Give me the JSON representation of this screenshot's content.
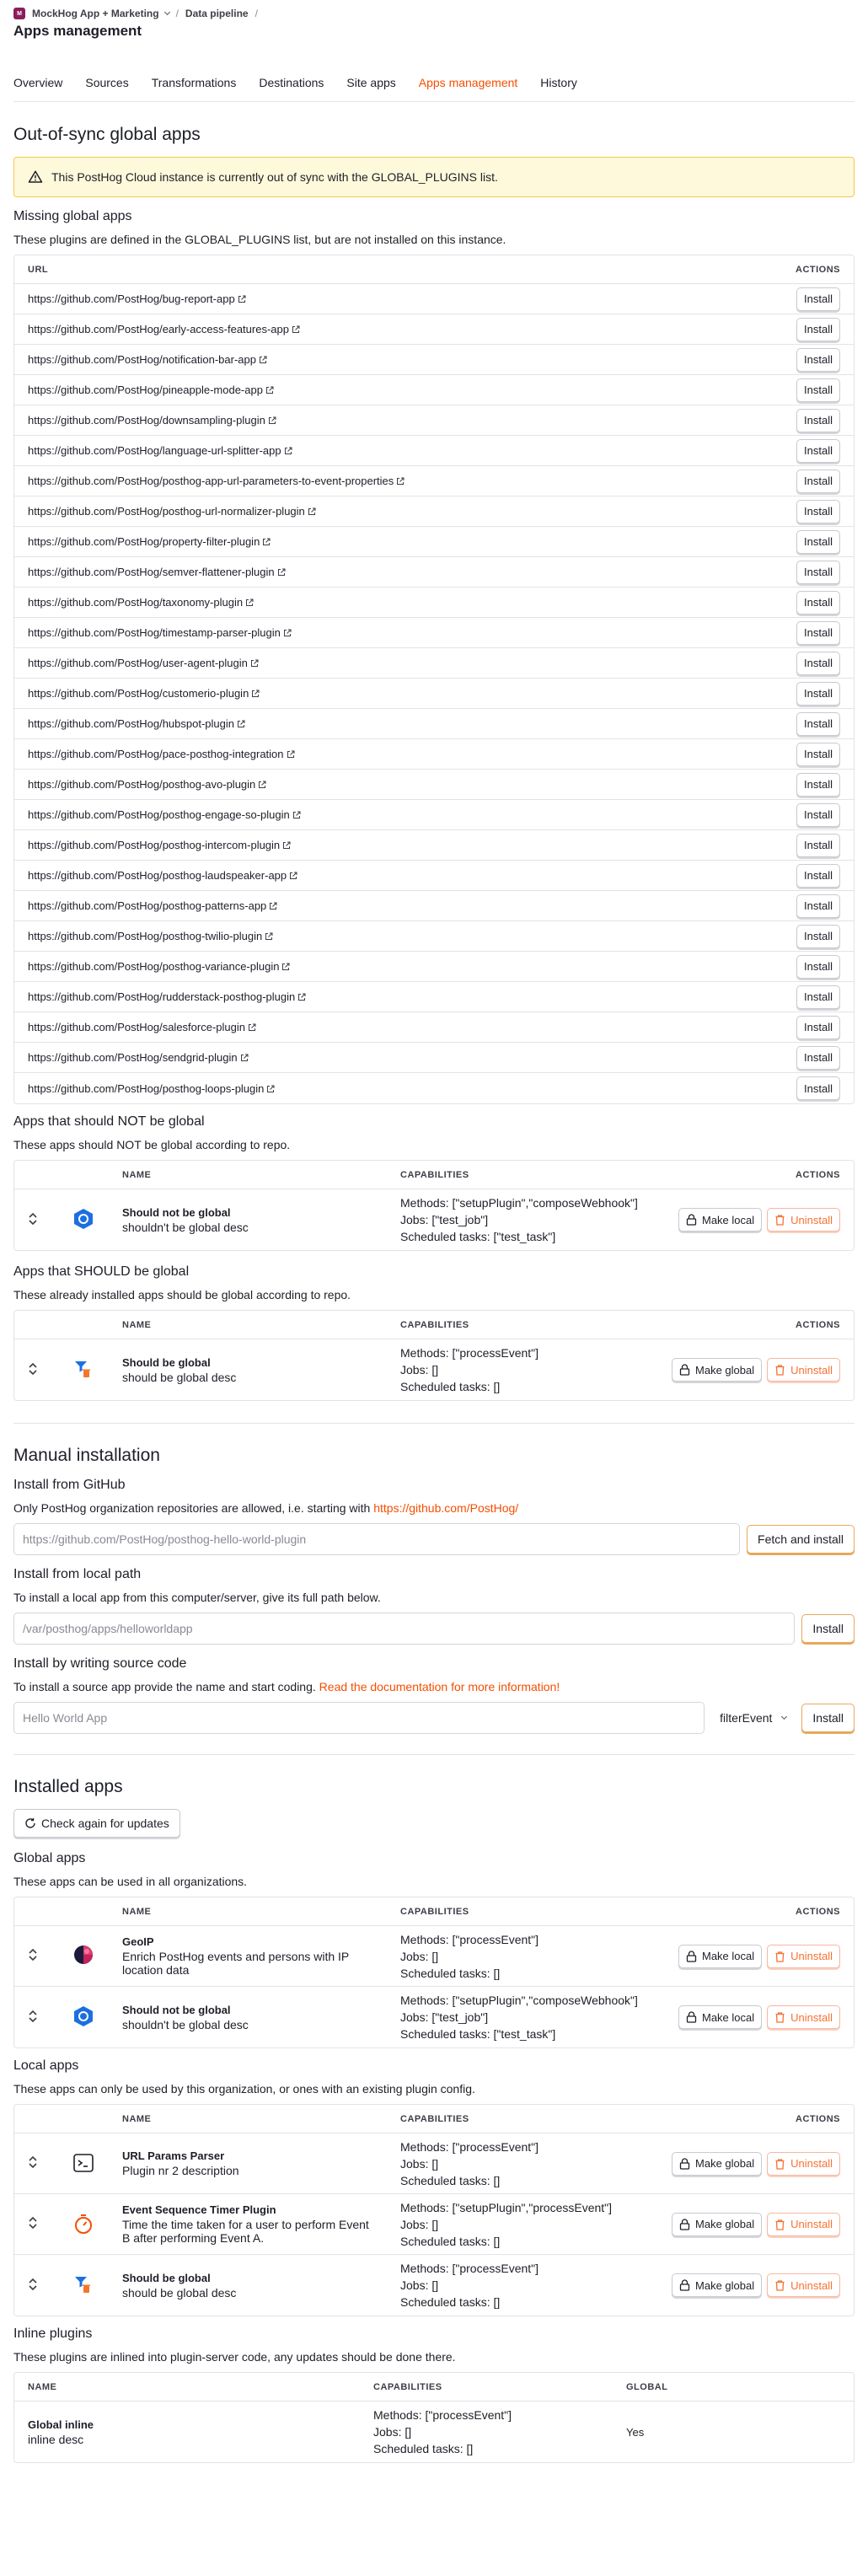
{
  "header": {
    "org_badge": "M",
    "breadcrumb_project": "MockHog App + Marketing",
    "breadcrumb_section": "Data pipeline",
    "title": "Apps management"
  },
  "tabs": [
    {
      "label": "Overview"
    },
    {
      "label": "Sources"
    },
    {
      "label": "Transformations"
    },
    {
      "label": "Destinations"
    },
    {
      "label": "Site apps"
    },
    {
      "label": "Apps management",
      "active": true
    },
    {
      "label": "History"
    }
  ],
  "outOfSync": {
    "title": "Out-of-sync global apps",
    "warning": "This PostHog Cloud instance is currently out of sync with the GLOBAL_PLUGINS list.",
    "missing": {
      "title": "Missing global apps",
      "desc": "These plugins are defined in the GLOBAL_PLUGINS list, but are not installed on this instance.",
      "col_url": "URL",
      "col_actions": "ACTIONS",
      "install_label": "Install",
      "urls": [
        "https://github.com/PostHog/bug-report-app",
        "https://github.com/PostHog/early-access-features-app",
        "https://github.com/PostHog/notification-bar-app",
        "https://github.com/PostHog/pineapple-mode-app",
        "https://github.com/PostHog/downsampling-plugin",
        "https://github.com/PostHog/language-url-splitter-app",
        "https://github.com/PostHog/posthog-app-url-parameters-to-event-properties",
        "https://github.com/PostHog/posthog-url-normalizer-plugin",
        "https://github.com/PostHog/property-filter-plugin",
        "https://github.com/PostHog/semver-flattener-plugin",
        "https://github.com/PostHog/taxonomy-plugin",
        "https://github.com/PostHog/timestamp-parser-plugin",
        "https://github.com/PostHog/user-agent-plugin",
        "https://github.com/PostHog/customerio-plugin",
        "https://github.com/PostHog/hubspot-plugin",
        "https://github.com/PostHog/pace-posthog-integration",
        "https://github.com/PostHog/posthog-avo-plugin",
        "https://github.com/PostHog/posthog-engage-so-plugin",
        "https://github.com/PostHog/posthog-intercom-plugin",
        "https://github.com/PostHog/posthog-laudspeaker-app",
        "https://github.com/PostHog/posthog-patterns-app",
        "https://github.com/PostHog/posthog-twilio-plugin",
        "https://github.com/PostHog/posthog-variance-plugin",
        "https://github.com/PostHog/rudderstack-posthog-plugin",
        "https://github.com/PostHog/salesforce-plugin",
        "https://github.com/PostHog/sendgrid-plugin",
        "https://github.com/PostHog/posthog-loops-plugin"
      ]
    },
    "notGlobal": {
      "title": "Apps that should NOT be global",
      "desc": "These apps should NOT be global according to repo.",
      "col_name": "NAME",
      "col_caps": "CAPABILITIES",
      "col_actions": "ACTIONS",
      "app": {
        "name": "Should not be global",
        "desc": "shouldn't be global desc",
        "methods": "Methods: [\"setupPlugin\",\"composeWebhook\"]",
        "jobs": "Jobs: [\"test_job\"]",
        "tasks": "Scheduled tasks: [\"test_task\"]",
        "action": "Make local",
        "uninstall": "Uninstall"
      }
    },
    "shouldGlobal": {
      "title": "Apps that SHOULD be global",
      "desc": "These already installed apps should be global according to repo.",
      "col_name": "NAME",
      "col_caps": "CAPABILITIES",
      "col_actions": "ACTIONS",
      "app": {
        "name": "Should be global",
        "desc": "should be global desc",
        "methods": "Methods: [\"processEvent\"]",
        "jobs": "Jobs: []",
        "tasks": "Scheduled tasks: []",
        "action": "Make global",
        "uninstall": "Uninstall"
      }
    }
  },
  "manual": {
    "title": "Manual installation",
    "github": {
      "title": "Install from GitHub",
      "desc": "Only PostHog organization repositories are allowed, i.e. starting with ",
      "link": "https://github.com/PostHog/",
      "placeholder": "https://github.com/PostHog/posthog-hello-world-plugin",
      "button": "Fetch and install"
    },
    "local": {
      "title": "Install from local path",
      "desc": "To install a local app from this computer/server, give its full path below.",
      "placeholder": "/var/posthog/apps/helloworldapp",
      "button": "Install"
    },
    "source": {
      "title": "Install by writing source code",
      "desc": "To install a source app provide the name and start coding. ",
      "link": "Read the documentation for more information!",
      "placeholder": "Hello World App",
      "select_value": "filterEvent",
      "button": "Install"
    }
  },
  "installed": {
    "title": "Installed apps",
    "check_button": "Check again for updates",
    "global": {
      "title": "Global apps",
      "desc": "These apps can be used in all organizations.",
      "col_name": "NAME",
      "col_caps": "CAPABILITIES",
      "col_actions": "ACTIONS",
      "apps": [
        {
          "name": "GeoIP",
          "desc": "Enrich PostHog events and persons with IP location data",
          "methods": "Methods: [\"processEvent\"]",
          "jobs": "Jobs: []",
          "tasks": "Scheduled tasks: []",
          "action": "Make local",
          "uninstall": "Uninstall",
          "icon": "geoip-icon"
        },
        {
          "name": "Should not be global",
          "desc": "shouldn't be global desc",
          "methods": "Methods: [\"setupPlugin\",\"composeWebhook\"]",
          "jobs": "Jobs: [\"test_job\"]",
          "tasks": "Scheduled tasks: [\"test_task\"]",
          "action": "Make local",
          "uninstall": "Uninstall",
          "icon": "hexagon-icon"
        }
      ]
    },
    "local": {
      "title": "Local apps",
      "desc": "These apps can only be used by this organization, or ones with an existing plugin config.",
      "col_name": "NAME",
      "col_caps": "CAPABILITIES",
      "col_actions": "ACTIONS",
      "apps": [
        {
          "name": "URL Params Parser",
          "desc": "Plugin nr 2 description",
          "methods": "Methods: [\"processEvent\"]",
          "jobs": "Jobs: []",
          "tasks": "Scheduled tasks: []",
          "action": "Make global",
          "uninstall": "Uninstall",
          "icon": "terminal-icon"
        },
        {
          "name": "Event Sequence Timer Plugin",
          "desc": "Time the time taken for a user to perform Event B after performing Event A.",
          "methods": "Methods: [\"setupPlugin\",\"processEvent\"]",
          "jobs": "Jobs: []",
          "tasks": "Scheduled tasks: []",
          "action": "Make global",
          "uninstall": "Uninstall",
          "icon": "timer-icon"
        },
        {
          "name": "Should be global",
          "desc": "should be global desc",
          "methods": "Methods: [\"processEvent\"]",
          "jobs": "Jobs: []",
          "tasks": "Scheduled tasks: []",
          "action": "Make global",
          "uninstall": "Uninstall",
          "icon": "filter-delete-icon"
        }
      ]
    },
    "inline": {
      "title": "Inline plugins",
      "desc": "These plugins are inlined into plugin-server code, any updates should be done there.",
      "col_name": "NAME",
      "col_caps": "CAPABILITIES",
      "col_global": "GLOBAL",
      "app": {
        "name": "Global inline",
        "desc": "inline desc",
        "methods": "Methods: [\"processEvent\"]",
        "jobs": "Jobs: []",
        "tasks": "Scheduled tasks: []",
        "global": "Yes"
      }
    }
  },
  "colors": {
    "accent": "#f54e00",
    "warning_bg": "#fff9db",
    "warning_border": "#f3c84b"
  }
}
